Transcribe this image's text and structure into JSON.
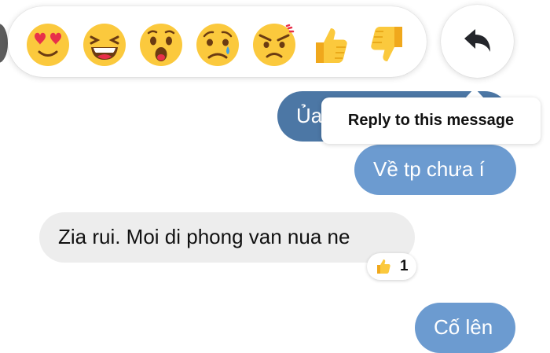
{
  "reaction_bar": {
    "reactions": [
      "heart-eyes",
      "laughing",
      "wow",
      "sad",
      "angry",
      "thumbs-up",
      "thumbs-down"
    ]
  },
  "reply_button": {
    "icon": "reply-arrow-icon"
  },
  "tooltip": {
    "text": "Reply to this message"
  },
  "messages": [
    {
      "direction": "outgoing",
      "text": "Ủa",
      "highlighted": true
    },
    {
      "direction": "outgoing",
      "text": "Về tp chưa í"
    },
    {
      "direction": "incoming",
      "text": "Zia rui. Moi di phong van nua ne",
      "reaction": {
        "icon": "thumbs-up",
        "count": "1"
      }
    },
    {
      "direction": "outgoing",
      "text": "Cố lên"
    }
  ],
  "colors": {
    "outgoing_bubble": "#6c9bd0",
    "outgoing_bubble_dimmed": "#4c77a5",
    "incoming_bubble": "#ededed",
    "emoji_yellow": "#fbc93d"
  }
}
